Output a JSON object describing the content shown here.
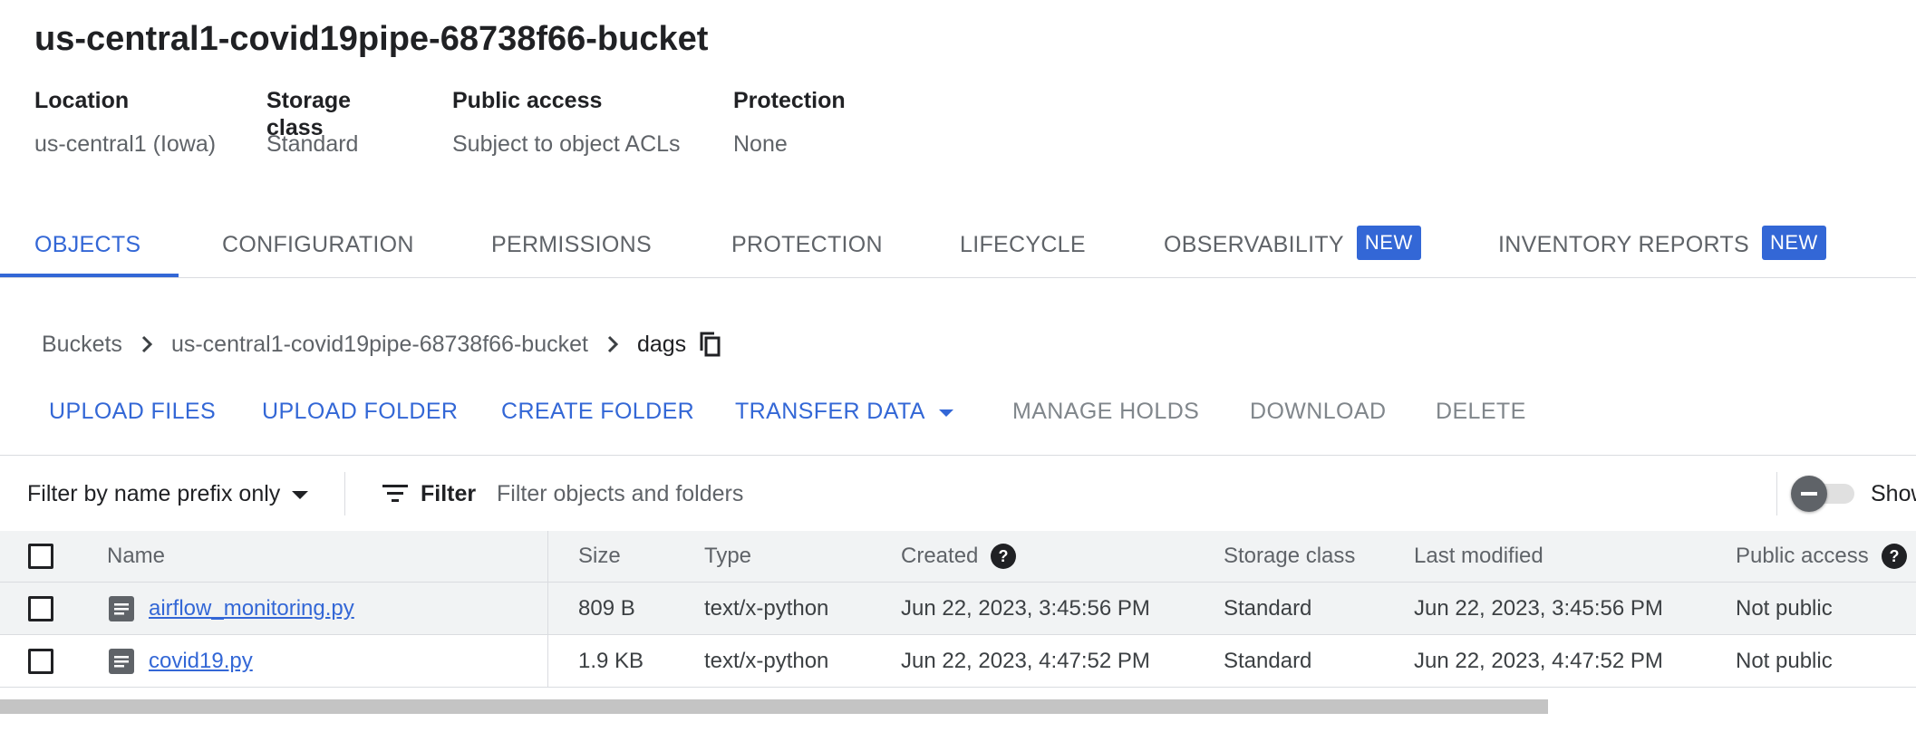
{
  "bucket": {
    "title": "us-central1-covid19pipe-68738f66-bucket",
    "properties": [
      {
        "label": "Location",
        "value": "us-central1 (Iowa)"
      },
      {
        "label": "Storage class",
        "value": "Standard"
      },
      {
        "label": "Public access",
        "value": "Subject to object ACLs"
      },
      {
        "label": "Protection",
        "value": "None"
      }
    ]
  },
  "tabs": [
    {
      "label": "OBJECTS",
      "active": true
    },
    {
      "label": "CONFIGURATION"
    },
    {
      "label": "PERMISSIONS"
    },
    {
      "label": "PROTECTION"
    },
    {
      "label": "LIFECYCLE"
    },
    {
      "label": "OBSERVABILITY",
      "badge": "NEW"
    },
    {
      "label": "INVENTORY REPORTS",
      "badge": "NEW"
    }
  ],
  "breadcrumb": {
    "root": "Buckets",
    "bucket": "us-central1-covid19pipe-68738f66-bucket",
    "current": "dags"
  },
  "toolbar": {
    "upload_files": "UPLOAD FILES",
    "upload_folder": "UPLOAD FOLDER",
    "create_folder": "CREATE FOLDER",
    "transfer_data": "TRANSFER DATA",
    "manage_holds": "MANAGE HOLDS",
    "download": "DOWNLOAD",
    "delete": "DELETE"
  },
  "filter": {
    "mode": "Filter by name prefix only",
    "button": "Filter",
    "placeholder": "Filter objects and folders",
    "toggle_label": "Show"
  },
  "table": {
    "headers": {
      "name": "Name",
      "size": "Size",
      "type": "Type",
      "created": "Created",
      "storage_class": "Storage class",
      "last_modified": "Last modified",
      "public_access": "Public access"
    },
    "rows": [
      {
        "name": "airflow_monitoring.py",
        "size": "809 B",
        "type": "text/x-python",
        "created": "Jun 22, 2023, 3:45:56 PM",
        "storage_class": "Standard",
        "last_modified": "Jun 22, 2023, 3:45:56 PM",
        "public_access": "Not public"
      },
      {
        "name": "covid19.py",
        "size": "1.9 KB",
        "type": "text/x-python",
        "created": "Jun 22, 2023, 4:47:52 PM",
        "storage_class": "Standard",
        "last_modified": "Jun 22, 2023, 4:47:52 PM",
        "public_access": "Not public"
      }
    ]
  },
  "icons": {
    "breadcrumb_separator": "chevron-right-icon",
    "copy": "copy-icon",
    "dropdown": "arrow-drop-down-icon",
    "filter": "filter-list-icon",
    "help": "help-icon",
    "file": "text-file-icon"
  },
  "colors": {
    "accent": "#3367d6",
    "text": "#202124",
    "muted_text": "#5f6368",
    "disabled_text": "#80868b",
    "header_bg": "#f1f3f4",
    "divider": "#dadce0"
  }
}
